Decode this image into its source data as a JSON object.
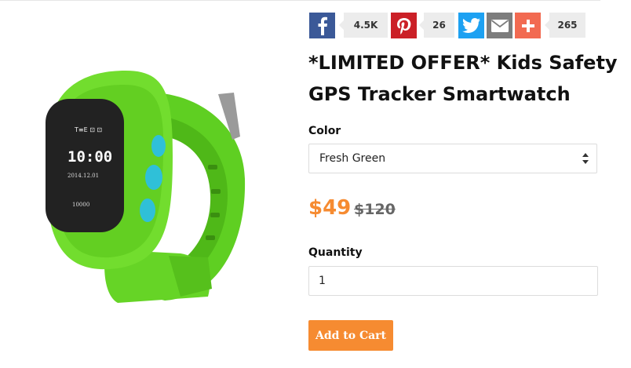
{
  "share": {
    "facebook_count": "4.5K",
    "pinterest_count": "26",
    "more_count": "265"
  },
  "product": {
    "title": "*LIMITED OFFER* Kids Safety GPS Tracker Smartwatch",
    "color_label": "Color",
    "color_value": "Fresh Green",
    "price": "$49",
    "compare_price": "$120",
    "quantity_label": "Quantity",
    "quantity_value": "1",
    "add_to_cart": "Add to Cart"
  },
  "watch_screen": {
    "status": "T≡E ⊡ ⊡",
    "time": "10:00",
    "date": "2014.12.01",
    "steps": "10000"
  },
  "colors": {
    "accent": "#f68b31",
    "facebook": "#3b5998",
    "pinterest": "#cb2027",
    "twitter": "#1da1f2",
    "email": "#7d7d7d",
    "plus": "#f26a51",
    "watch_green": "#6edb2b"
  },
  "icons": [
    "facebook-icon",
    "pinterest-icon",
    "twitter-icon",
    "email-icon",
    "plus-icon",
    "select-arrows-icon"
  ]
}
